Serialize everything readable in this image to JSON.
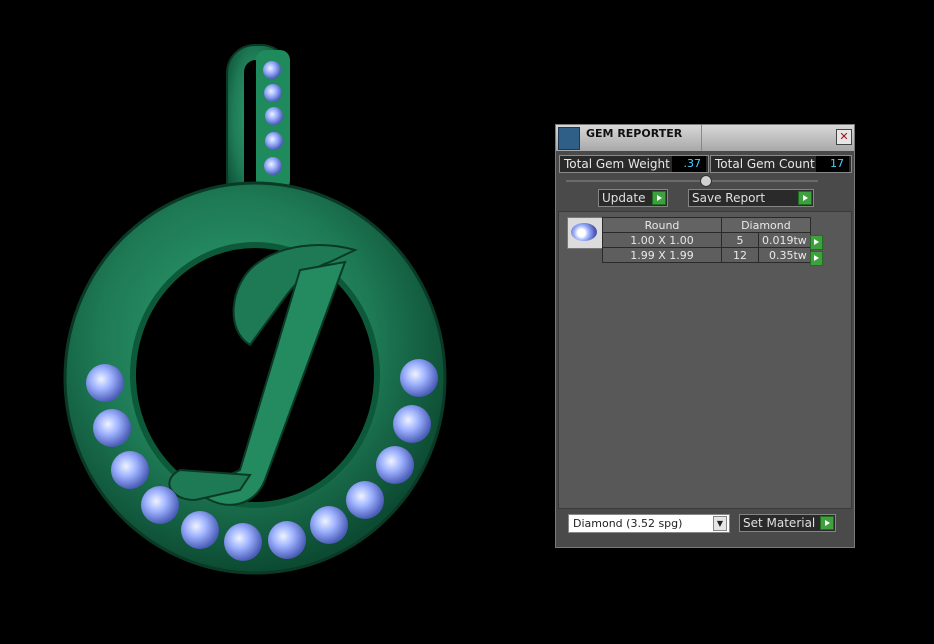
{
  "panel": {
    "title": "GEM REPORTER",
    "close_label": "✕",
    "total_weight_label": "Total Gem Weight",
    "total_weight_value": ".37",
    "total_count_label": "Total Gem Count",
    "total_count_value": "17",
    "update_label": "Update",
    "save_report_label": "Save Report",
    "table": {
      "headers": [
        "Round",
        "Diamond"
      ],
      "rows": [
        {
          "size": "1.00 X 1.00",
          "count": "5",
          "weight": "0.019tw"
        },
        {
          "size": "1.99 X 1.99",
          "count": "12",
          "weight": "0.35tw"
        }
      ]
    },
    "material_select_value": "Diamond    (3.52 spg)",
    "set_material_label": "Set Material"
  },
  "colors": {
    "metal": "#1e7a55",
    "gem": "#9fb3ff",
    "value_text": "#4dd0ff",
    "play_button": "#3ea03e"
  },
  "icons": {
    "gem_thumbnail": "round-diamond-icon",
    "app": "gem-reporter-icon"
  }
}
